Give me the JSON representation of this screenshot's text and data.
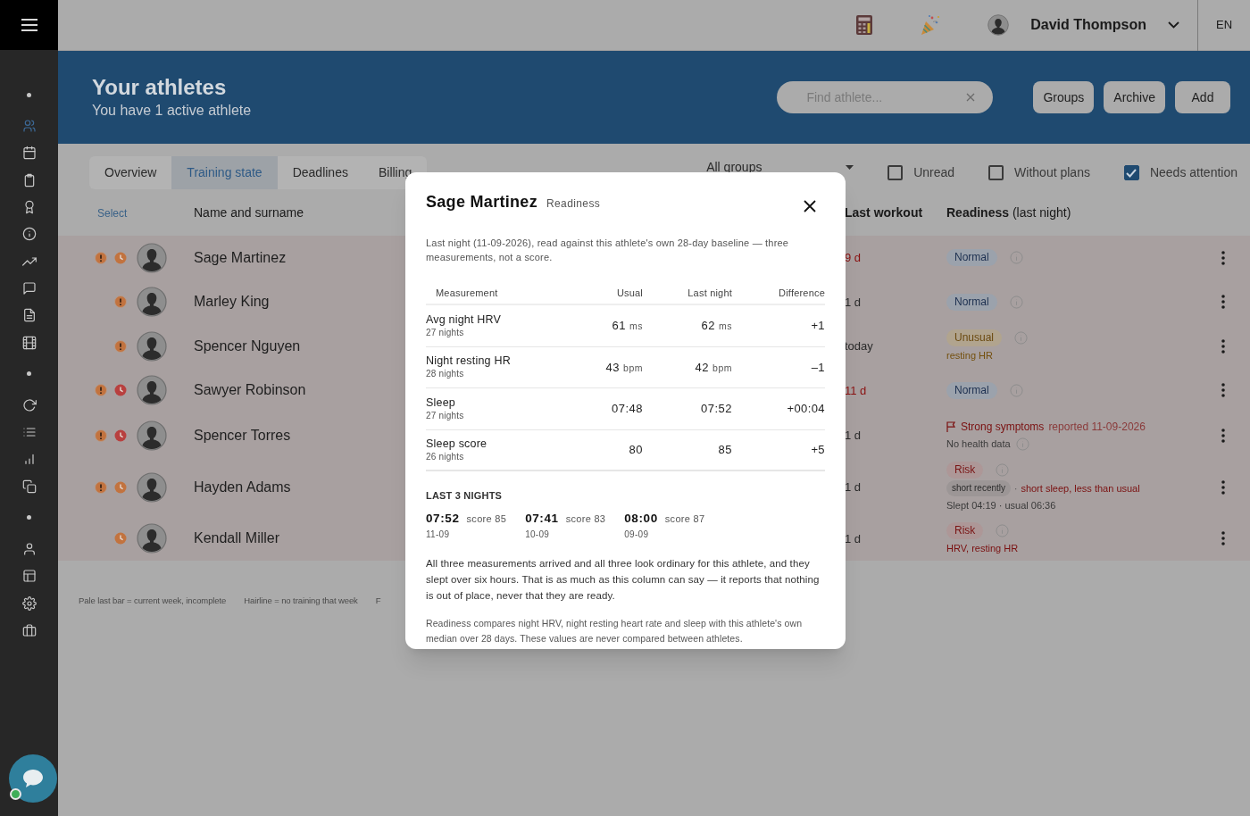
{
  "sidebar": {
    "items": [
      {
        "kind": "dot"
      },
      {
        "kind": "link",
        "selected": true
      },
      {
        "kind": "link",
        "selected": false
      },
      {
        "kind": "link",
        "selected": false
      },
      {
        "kind": "link",
        "selected": false
      },
      {
        "kind": "link",
        "selected": false
      },
      {
        "kind": "link",
        "selected": false
      },
      {
        "kind": "link",
        "selected": false
      },
      {
        "kind": "link",
        "selected": false
      },
      {
        "kind": "link",
        "selected": false
      },
      {
        "kind": "dot"
      },
      {
        "kind": "link",
        "selected": false
      },
      {
        "kind": "link",
        "selected": false
      },
      {
        "kind": "link",
        "selected": false
      },
      {
        "kind": "link",
        "selected": false
      },
      {
        "kind": "dot"
      },
      {
        "kind": "link",
        "selected": false
      },
      {
        "kind": "link",
        "selected": false
      },
      {
        "kind": "link",
        "selected": false
      },
      {
        "kind": "link",
        "selected": false
      }
    ]
  },
  "topbar": {
    "user": "David Thompson",
    "language": "EN"
  },
  "header": {
    "title": "Your athletes",
    "subtitle": "You have 1 active athlete",
    "search": {
      "placeholder": "Find athlete..."
    },
    "buttons": [
      "Groups",
      "Archive",
      "Add"
    ]
  },
  "tabs": [
    {
      "label": "Overview",
      "selected": false
    },
    {
      "label": "Training state",
      "selected": true
    },
    {
      "label": "Deadlines",
      "selected": false
    },
    {
      "label": "Billing",
      "selected": false
    }
  ],
  "group_filter": "All groups",
  "filters": [
    {
      "label": "Unread",
      "checked": false
    },
    {
      "label": "Without plans",
      "checked": false
    },
    {
      "label": "Needs attention",
      "checked": true
    }
  ],
  "table": {
    "columns": [
      "Select",
      "Name and surname",
      "Last workout",
      "**Readiness** (last night)"
    ],
    "rows": [
      {
        "alert": true,
        "clock": {
          "color": "#c2733f"
        },
        "name": "Sage Martinez",
        "last_workout": "9 d",
        "overdue": true,
        "readiness": {
          "kind": "badge",
          "badge": {
            "label": "Normal",
            "kind": "normal"
          }
        }
      },
      {
        "alert": true,
        "name": "Marley King",
        "last_workout": "1 d",
        "overdue": false,
        "readiness": {
          "kind": "badge",
          "badge": {
            "label": "Normal",
            "kind": "normal"
          }
        }
      },
      {
        "alert": true,
        "name": "Spencer Nguyen",
        "last_workout": "today",
        "overdue": false,
        "readiness": {
          "kind": "badge",
          "badge": {
            "label": "Unusual",
            "kind": "unusual"
          },
          "detail": "resting HR"
        }
      },
      {
        "alert": true,
        "clock": {
          "color": "#b8403f"
        },
        "name": "Sawyer Robinson",
        "last_workout": "11 d",
        "overdue": true,
        "readiness": {
          "kind": "badge",
          "badge": {
            "label": "Normal",
            "kind": "normal"
          }
        }
      },
      {
        "alert": true,
        "clock": {
          "color": "#b8403f"
        },
        "name": "Spencer Torres",
        "last_workout": "1 d",
        "overdue": false,
        "readiness": {
          "kind": "symptoms",
          "flag": "Strong symptoms",
          "flag_note": "reported 11-09-2026",
          "note": "No health data"
        }
      },
      {
        "alert": true,
        "clock": {
          "color": "#c2733f"
        },
        "name": "Hayden Adams",
        "last_workout": "1 d",
        "overdue": false,
        "readiness": {
          "kind": "badge",
          "badge": {
            "label": "Risk",
            "kind": "risk"
          },
          "tag": "short recently",
          "separator": "·",
          "detail": "short sleep, less than usual",
          "note": "Slept 04:19 · usual 06:36"
        }
      },
      {
        "alert": false,
        "clock": {
          "color": "#c2733f"
        },
        "name": "Kendall Miller",
        "last_workout": "1 d",
        "overdue": false,
        "readiness": {
          "kind": "badge",
          "badge": {
            "label": "Risk",
            "kind": "risk"
          },
          "detail": "HRV, resting HR"
        }
      }
    ]
  },
  "legend": [
    "Pale last bar = current week, incomplete",
    "Hairline = no training that week",
    "F"
  ],
  "dialog": {
    "title": "Sage Martinez",
    "subtitle": "Readiness",
    "intro": "Last night (11-09-2026), read against this athlete's own 28-day baseline — three measurements, not a score.",
    "columns": [
      "Measurement",
      "Usual",
      "Last night",
      "Difference"
    ],
    "rows": [
      {
        "name": "Avg night HRV",
        "nights": "27 nights",
        "usual": "61",
        "usual_unit": "ms",
        "last": "62",
        "last_unit": "ms",
        "difference": "+1"
      },
      {
        "name": "Night resting HR",
        "nights": "28 nights",
        "usual": "43",
        "usual_unit": "bpm",
        "last": "42",
        "last_unit": "bpm",
        "difference": "–1"
      },
      {
        "name": "Sleep",
        "nights": "27 nights",
        "usual": "07:48",
        "last": "07:52",
        "difference": "+00:04"
      },
      {
        "name": "Sleep score",
        "nights": "26 nights",
        "usual": "80",
        "last": "85",
        "difference": "+5"
      }
    ],
    "nights_title": "LAST 3 NIGHTS",
    "nights": [
      {
        "time": "07:52",
        "score": "score 85",
        "date": "11-09"
      },
      {
        "time": "07:41",
        "score": "score 83",
        "date": "10-09"
      },
      {
        "time": "08:00",
        "score": "score 87",
        "date": "09-09"
      }
    ],
    "summary": "All three measurements arrived and all three look ordinary for this athlete, and they slept over six hours. That is as much as this column can say — it reports that nothing is out of place, never that they are ready.",
    "footnote": "Readiness compares night HRV, night resting heart rate and sleep with this athlete's own median over 28 days. These values are never compared between athletes."
  }
}
